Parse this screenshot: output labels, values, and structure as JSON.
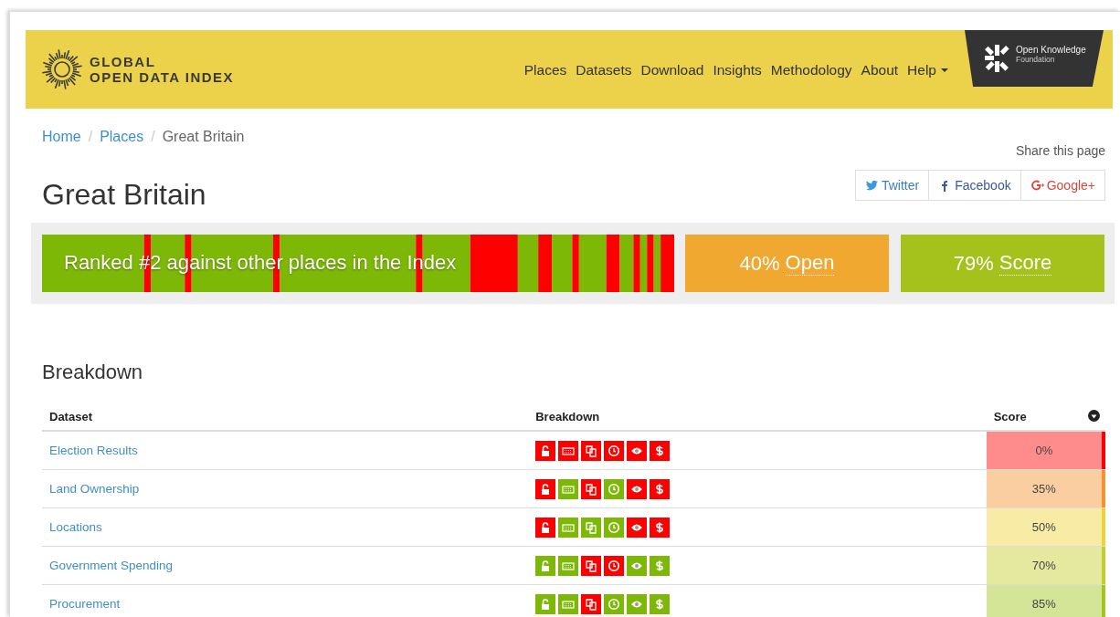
{
  "header": {
    "logo": {
      "line_1": "GLOBAL",
      "line_2": "OPEN DATA INDEX"
    },
    "nav": [
      {
        "label": "Places",
        "dropdown": false
      },
      {
        "label": "Datasets",
        "dropdown": false
      },
      {
        "label": "Download",
        "dropdown": false
      },
      {
        "label": "Insights",
        "dropdown": false
      },
      {
        "label": "Methodology",
        "dropdown": false
      },
      {
        "label": "About",
        "dropdown": false
      },
      {
        "label": "Help",
        "dropdown": true
      }
    ],
    "partner": {
      "line_1": "Open Knowledge",
      "line_2": "Foundation"
    }
  },
  "breadcrumb_separator": "/",
  "breadcrumb": [
    {
      "label": "Home",
      "link": true
    },
    {
      "label": "Places",
      "link": true
    },
    {
      "label": "Great Britain",
      "link": false
    }
  ],
  "share": {
    "label": "Share this page",
    "buttons": [
      {
        "kind": "twitter",
        "label": "Twitter"
      },
      {
        "kind": "facebook",
        "label": "Facebook"
      },
      {
        "kind": "google",
        "label": "Google+"
      }
    ]
  },
  "title": "Great Britain",
  "summary": {
    "rank_text": "Ranked #2 against other places in the Index",
    "open": {
      "value": "40%",
      "label": "Open"
    },
    "score": {
      "value": "79%",
      "label": "Score"
    }
  },
  "breakdown": {
    "heading": "Breakdown",
    "columns": [
      "Dataset",
      "Breakdown",
      "Score"
    ],
    "rows": [
      {
        "dataset": "Election Results",
        "score": "0%",
        "color": "#ff0000",
        "checks": [
          {
            "kind": "license",
            "met": false
          },
          {
            "kind": "machine",
            "met": false
          },
          {
            "kind": "bulk",
            "met": false
          },
          {
            "kind": "timely",
            "met": false
          },
          {
            "kind": "public",
            "met": false
          },
          {
            "kind": "free",
            "met": false
          }
        ]
      },
      {
        "dataset": "Land Ownership",
        "score": "35%",
        "color": "#f4922c",
        "checks": [
          {
            "kind": "license",
            "met": false
          },
          {
            "kind": "machine",
            "met": true
          },
          {
            "kind": "bulk",
            "met": false
          },
          {
            "kind": "timely",
            "met": true
          },
          {
            "kind": "public",
            "met": false
          },
          {
            "kind": "free",
            "met": false
          }
        ]
      },
      {
        "dataset": "Locations",
        "score": "50%",
        "color": "#edd33a",
        "checks": [
          {
            "kind": "license",
            "met": false
          },
          {
            "kind": "machine",
            "met": true
          },
          {
            "kind": "bulk",
            "met": true
          },
          {
            "kind": "timely",
            "met": true
          },
          {
            "kind": "public",
            "met": false
          },
          {
            "kind": "free",
            "met": false
          }
        ]
      },
      {
        "dataset": "Government Spending",
        "score": "70%",
        "color": "#c2cf2a",
        "checks": [
          {
            "kind": "license",
            "met": true
          },
          {
            "kind": "machine",
            "met": true
          },
          {
            "kind": "bulk",
            "met": false
          },
          {
            "kind": "timely",
            "met": false
          },
          {
            "kind": "public",
            "met": true
          },
          {
            "kind": "free",
            "met": true
          }
        ]
      },
      {
        "dataset": "Procurement",
        "score": "85%",
        "color": "#a2c61a",
        "checks": [
          {
            "kind": "license",
            "met": true
          },
          {
            "kind": "machine",
            "met": true
          },
          {
            "kind": "bulk",
            "met": false
          },
          {
            "kind": "timely",
            "met": true
          },
          {
            "kind": "public",
            "met": true
          },
          {
            "kind": "free",
            "met": true
          }
        ]
      }
    ]
  }
}
